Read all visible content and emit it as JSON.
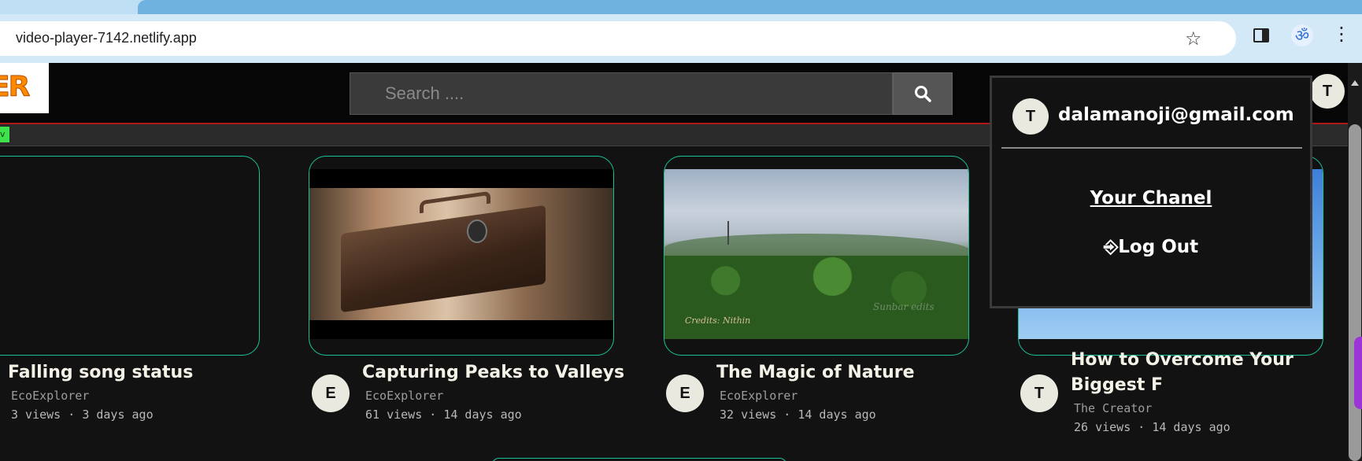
{
  "browser": {
    "url": "video-player-7142.netlify.app",
    "icons": {
      "site": "site-info-icon",
      "star": "bookmark-star-icon",
      "side_panel": "side-panel-icon",
      "extension": "om-extension-icon",
      "menu": "kebab-menu-icon"
    }
  },
  "header": {
    "logo_text": "ER",
    "search_placeholder": "Search ....",
    "search_icon": "search-icon",
    "user_initial": "T"
  },
  "category_strip": {
    "chip_text": "v"
  },
  "videos": [
    {
      "title": "Falling song status",
      "channel": "EcoExplorer",
      "views": "3 views",
      "age": "3 days ago",
      "avatar": ""
    },
    {
      "title": "Capturing Peaks to Valleys",
      "channel": "EcoExplorer",
      "views": "61 views",
      "age": "14 days ago",
      "avatar": "E"
    },
    {
      "title": "The Magic of Nature",
      "channel": "EcoExplorer",
      "views": "32 views",
      "age": "14 days ago",
      "avatar": "E",
      "thumb_credit": "Credits: Nithin",
      "thumb_watermark": "Sunbar edits"
    },
    {
      "title": "How to Overcome Your Biggest F",
      "channel": "The Creator",
      "views": "26 views",
      "age": "14 days ago",
      "avatar": "T"
    }
  ],
  "meta_separator": "·",
  "account_menu": {
    "avatar_initial": "T",
    "email": "dalamanoji@gmail.com",
    "your_channel": "Your Chanel",
    "logout_icon": "⎆",
    "logout": "Log Out"
  },
  "colors": {
    "card_border": "#18c39a",
    "header_border": "#b01818",
    "accent_purple": "#9b35d8"
  }
}
